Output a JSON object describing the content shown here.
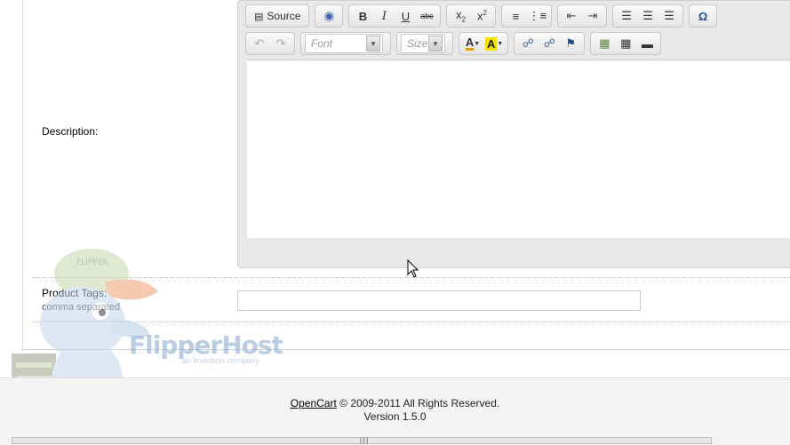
{
  "form": {
    "description_label": "Description:",
    "tags_label": "Product Tags:",
    "tags_help": "comma separated",
    "tags_value": ""
  },
  "editor": {
    "source_label": "Source",
    "font_placeholder": "Font",
    "size_placeholder": "Size",
    "toolbar_row1": [
      "source",
      "preview",
      "bold",
      "italic",
      "underline",
      "strike",
      "subscript",
      "superscript",
      "numbered-list",
      "bulleted-list",
      "outdent",
      "indent",
      "align-left",
      "align-center",
      "align-right",
      "special-char"
    ],
    "toolbar_row2": [
      "undo",
      "redo",
      "font",
      "size",
      "text-color",
      "bg-color",
      "link",
      "unlink",
      "anchor",
      "image",
      "table",
      "horizontal-rule"
    ]
  },
  "watermark": {
    "brand": "FlipperHost",
    "tagline": "an investion company",
    "cap_text": "FLIPPER HOST"
  },
  "footer": {
    "link_text": "OpenCart",
    "rights": " © 2009-2011 All Rights Reserved.",
    "version": "Version 1.5.0"
  },
  "colors": {
    "toolbar_bg": "#e8e8e8",
    "border": "#c8c8c8",
    "footer_bg": "#f4f4f4"
  }
}
